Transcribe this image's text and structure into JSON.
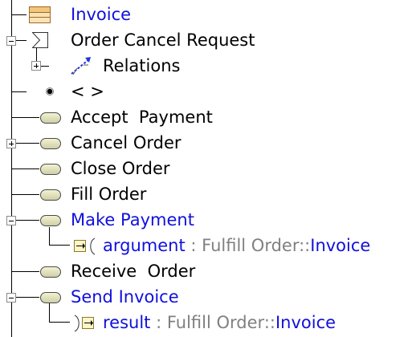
{
  "tree": {
    "invoice_label": "Invoice",
    "order_cancel_request_label": "Order Cancel Request",
    "relations_label": "Relations",
    "unnamed_label": "< >",
    "accept_payment_label": "Accept  Payment",
    "cancel_order_label": "Cancel Order",
    "close_order_label": "Close Order",
    "fill_order_label": "Fill Order",
    "make_payment_label": "Make Payment",
    "argument": {
      "name": "argument",
      "sep": " : ",
      "type_prefix": "Fulfill Order::",
      "type_name": "Invoice"
    },
    "receive_order_label": "Receive  Order",
    "send_invoice_label": "Send Invoice",
    "result": {
      "name": "result",
      "sep": " : ",
      "type_prefix": "Fulfill Order::",
      "type_name": "Invoice"
    }
  },
  "colors": {
    "link": "#1010dd",
    "type_gray": "#808080"
  },
  "icons": {
    "invoice": "class-icon",
    "order_cancel_request": "signal-icon",
    "relations": "relations-icon",
    "unnamed": "radio-node-icon",
    "operation": "operation-pill-icon",
    "parameter": "parameter-icon"
  }
}
